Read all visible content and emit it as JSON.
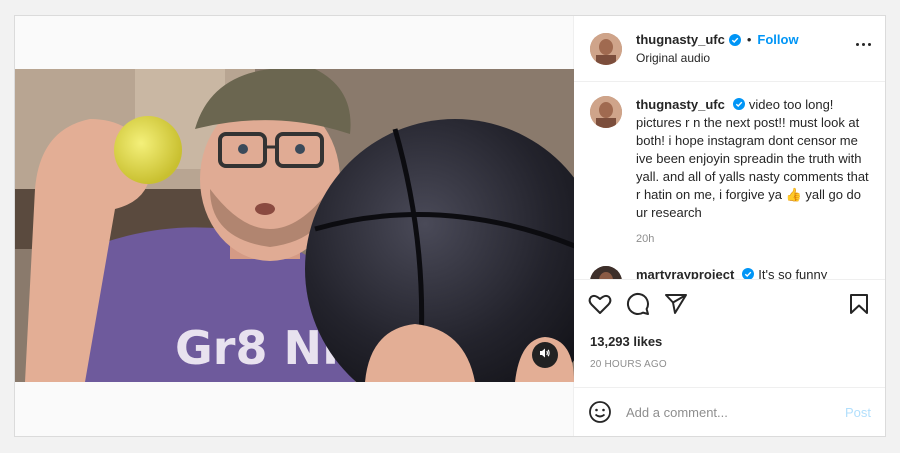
{
  "post": {
    "author": "thugnasty_ufc",
    "follow_label": "Follow",
    "separator": "•",
    "audio_label": "Original audio",
    "caption_text": "video too long! pictures r n the next post!! must look at both! i hope instagram dont censor me ive been enjoyin spreadin the truth with yall. and all of yalls nasty comments that r hatin on me, i forgive ya 👍 yall go do ur research",
    "caption_time": "20h",
    "shirt_text": "Gr8 NRG",
    "likes": "13,293 likes",
    "posted_ago": "20 HOURS AGO"
  },
  "comments": [
    {
      "author": "martyrayproject",
      "text": "It's so funny"
    }
  ],
  "comment_box": {
    "placeholder": "Add a comment...",
    "post_label": "Post"
  },
  "icons": {
    "verified": "verified-badge-icon",
    "more": "more-options-icon",
    "like": "heart-icon",
    "comment": "comment-icon",
    "share": "share-icon",
    "save": "bookmark-icon",
    "emoji": "emoji-icon",
    "sound": "speaker-icon"
  },
  "colors": {
    "accent": "#0095f6",
    "post_disabled": "#b2dffc",
    "border": "#dbdbdb"
  }
}
